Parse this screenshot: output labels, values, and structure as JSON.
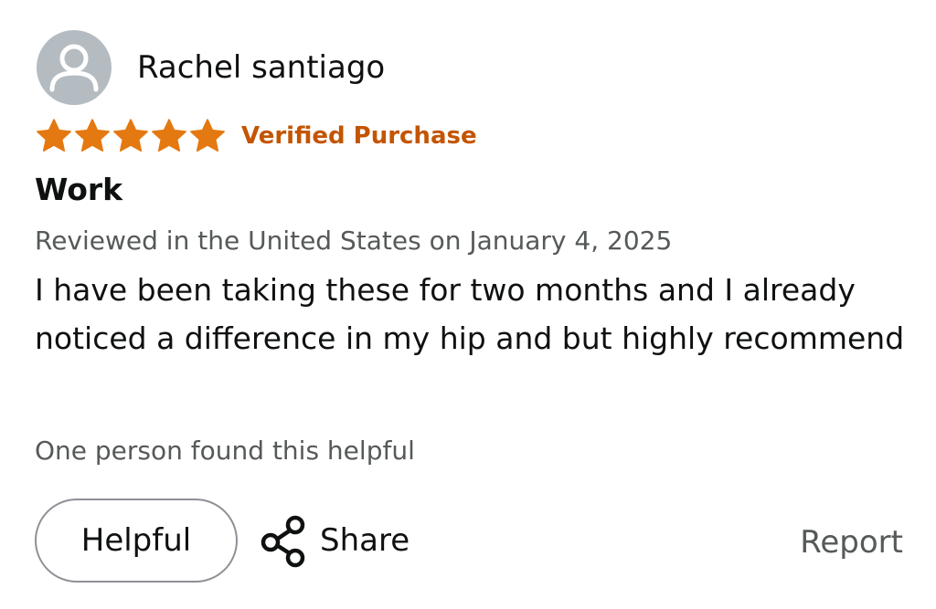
{
  "review": {
    "reviewer_name": "Rachel santiago",
    "rating_stars": 5,
    "rating_max": 5,
    "verified_label": "Verified Purchase",
    "title": "Work",
    "date_text": "Reviewed in the United States on January 4, 2025",
    "body": "I have been taking these for two months and I already noticed a difference in my hip and but highly recommend",
    "helpful_count_text": "One person found this helpful"
  },
  "actions": {
    "helpful_label": "Helpful",
    "share_label": "Share",
    "report_label": "Report"
  },
  "icons": {
    "avatar": "user-avatar-icon",
    "star": "star-icon",
    "share": "share-icon"
  },
  "colors": {
    "star": "#e47911",
    "verified": "#c45500",
    "secondary_text": "#565959",
    "avatar_bg": "#b4bcc1"
  }
}
